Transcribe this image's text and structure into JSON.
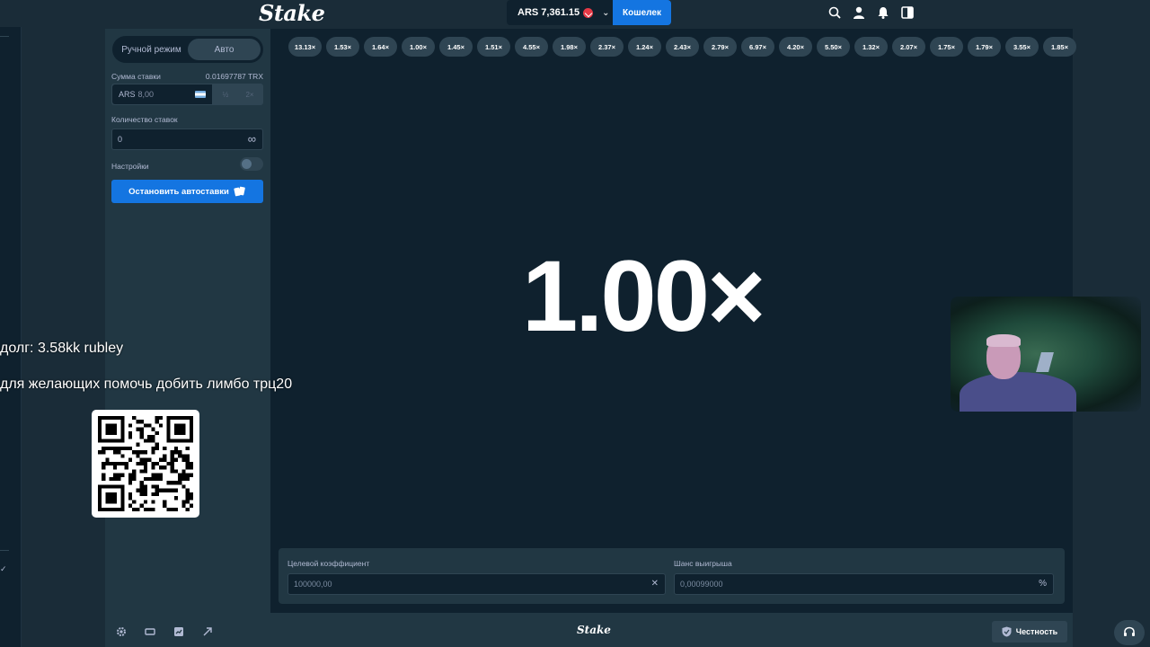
{
  "header": {
    "logo": "Stake",
    "balance": "ARS 7,361.15",
    "wallet_label": "Кошелек",
    "icons": [
      "search-icon",
      "user-icon",
      "bell-icon",
      "sidebar-toggle-icon"
    ]
  },
  "sidebar": {
    "mode_manual": "Ручной режим",
    "mode_auto": "Авто",
    "active_mode": "Авто",
    "bet_amount_label": "Сумма ставки",
    "bet_amount_crypto": "0.01697787 TRX",
    "bet_currency": "ARS",
    "bet_value": "8,00",
    "half_label": "½",
    "double_label": "2×",
    "bet_count_label": "Количество ставок",
    "bet_count_value": "0",
    "infinity_symbol": "∞",
    "settings_label": "Настройки",
    "settings_enabled": false,
    "stop_autobet_label": "Остановить автоставки"
  },
  "game": {
    "history": [
      "13.13×",
      "1.53×",
      "1.64×",
      "1.00×",
      "1.45×",
      "1.51×",
      "4.55×",
      "1.98×",
      "2.37×",
      "1.24×",
      "2.43×",
      "2.79×",
      "6.97×",
      "4.20×",
      "5.50×",
      "1.32×",
      "2.07×",
      "1.75×",
      "1.79×",
      "3.55×",
      "1.85×"
    ],
    "current_multiplier": "1.00×",
    "target_multiplier_label": "Целевой коэффициент",
    "target_multiplier_value": "100000,00",
    "target_suffix": "✕",
    "win_chance_label": "Шанс выигрыша",
    "win_chance_value": "0,00099000",
    "win_chance_suffix": "%"
  },
  "footer": {
    "logo": "Stake",
    "fairness_label": "Честность",
    "icons": [
      "settings-icon",
      "theatre-mode-icon",
      "stats-icon",
      "popout-icon"
    ]
  },
  "overlay": {
    "debt_text": "долг: 3.58kk rubley",
    "help_text": "для желающих помочь добить лимбо трц20"
  },
  "colors": {
    "background": "#1a2c38",
    "panel": "#213743",
    "game_bg": "#0f212e",
    "accent_blue": "#1475e1",
    "chip": "#2f4553"
  }
}
